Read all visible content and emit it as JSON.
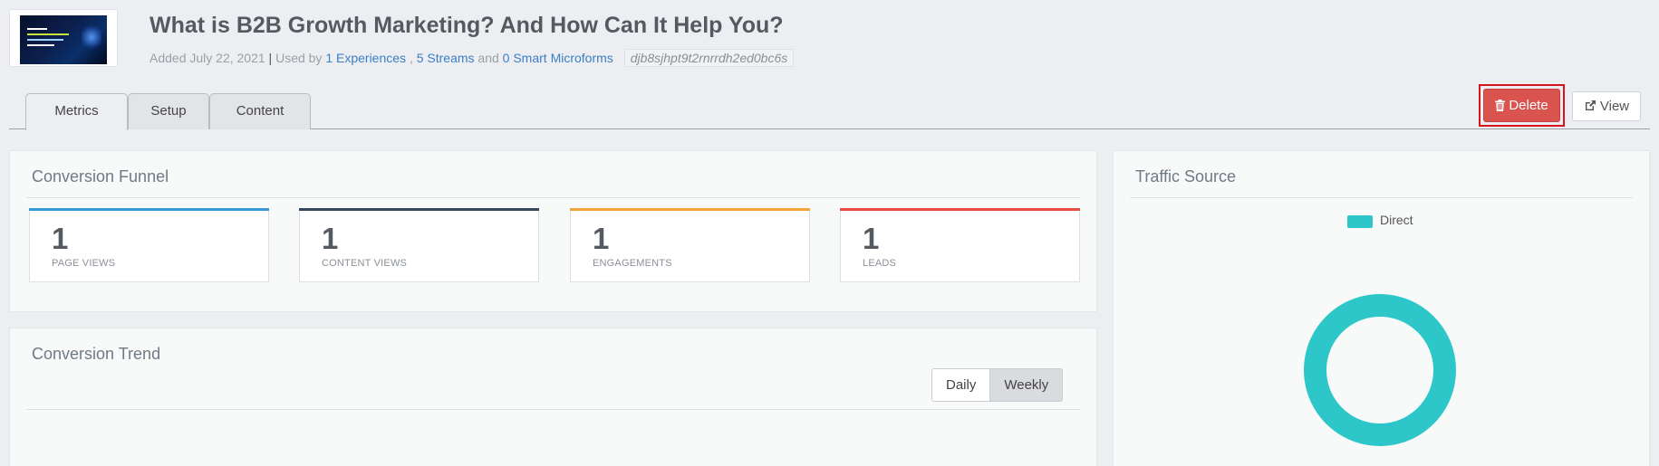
{
  "header": {
    "title": "What is B2B Growth Marketing? And How Can It Help You?",
    "added": "Added July 22, 2021",
    "separator": "|",
    "used_by": "Used by",
    "experiences_link": "1 Experiences",
    "comma": ",",
    "streams_link": "5 Streams",
    "and": "and",
    "microforms_link": "0 Smart Microforms",
    "content_id": "djb8sjhpt9t2rnrrdh2ed0bc6s"
  },
  "tabs": [
    {
      "label": "Metrics",
      "active": true
    },
    {
      "label": "Setup",
      "active": false
    },
    {
      "label": "Content",
      "active": false
    }
  ],
  "actions": {
    "delete_label": "Delete",
    "delete_icon": "trash-icon",
    "view_label": "View",
    "view_icon": "external-link-icon"
  },
  "funnel": {
    "title": "Conversion Funnel",
    "cards": [
      {
        "value": "1",
        "label": "PAGE VIEWS",
        "color": "#3a9ad9"
      },
      {
        "value": "1",
        "label": "CONTENT VIEWS",
        "color": "#34495e"
      },
      {
        "value": "1",
        "label": "ENGAGEMENTS",
        "color": "#f3a33a"
      },
      {
        "value": "1",
        "label": "LEADS",
        "color": "#e74c3c"
      }
    ]
  },
  "trend": {
    "title": "Conversion Trend",
    "toggle_daily": "Daily",
    "toggle_weekly": "Weekly",
    "selected": "Weekly"
  },
  "traffic": {
    "title": "Traffic Source",
    "legend": [
      {
        "name": "Direct",
        "color": "#2ec7c9"
      }
    ]
  },
  "chart_data": {
    "type": "pie",
    "title": "Traffic Source",
    "categories": [
      "Direct"
    ],
    "values": [
      1
    ],
    "legend": "top"
  }
}
